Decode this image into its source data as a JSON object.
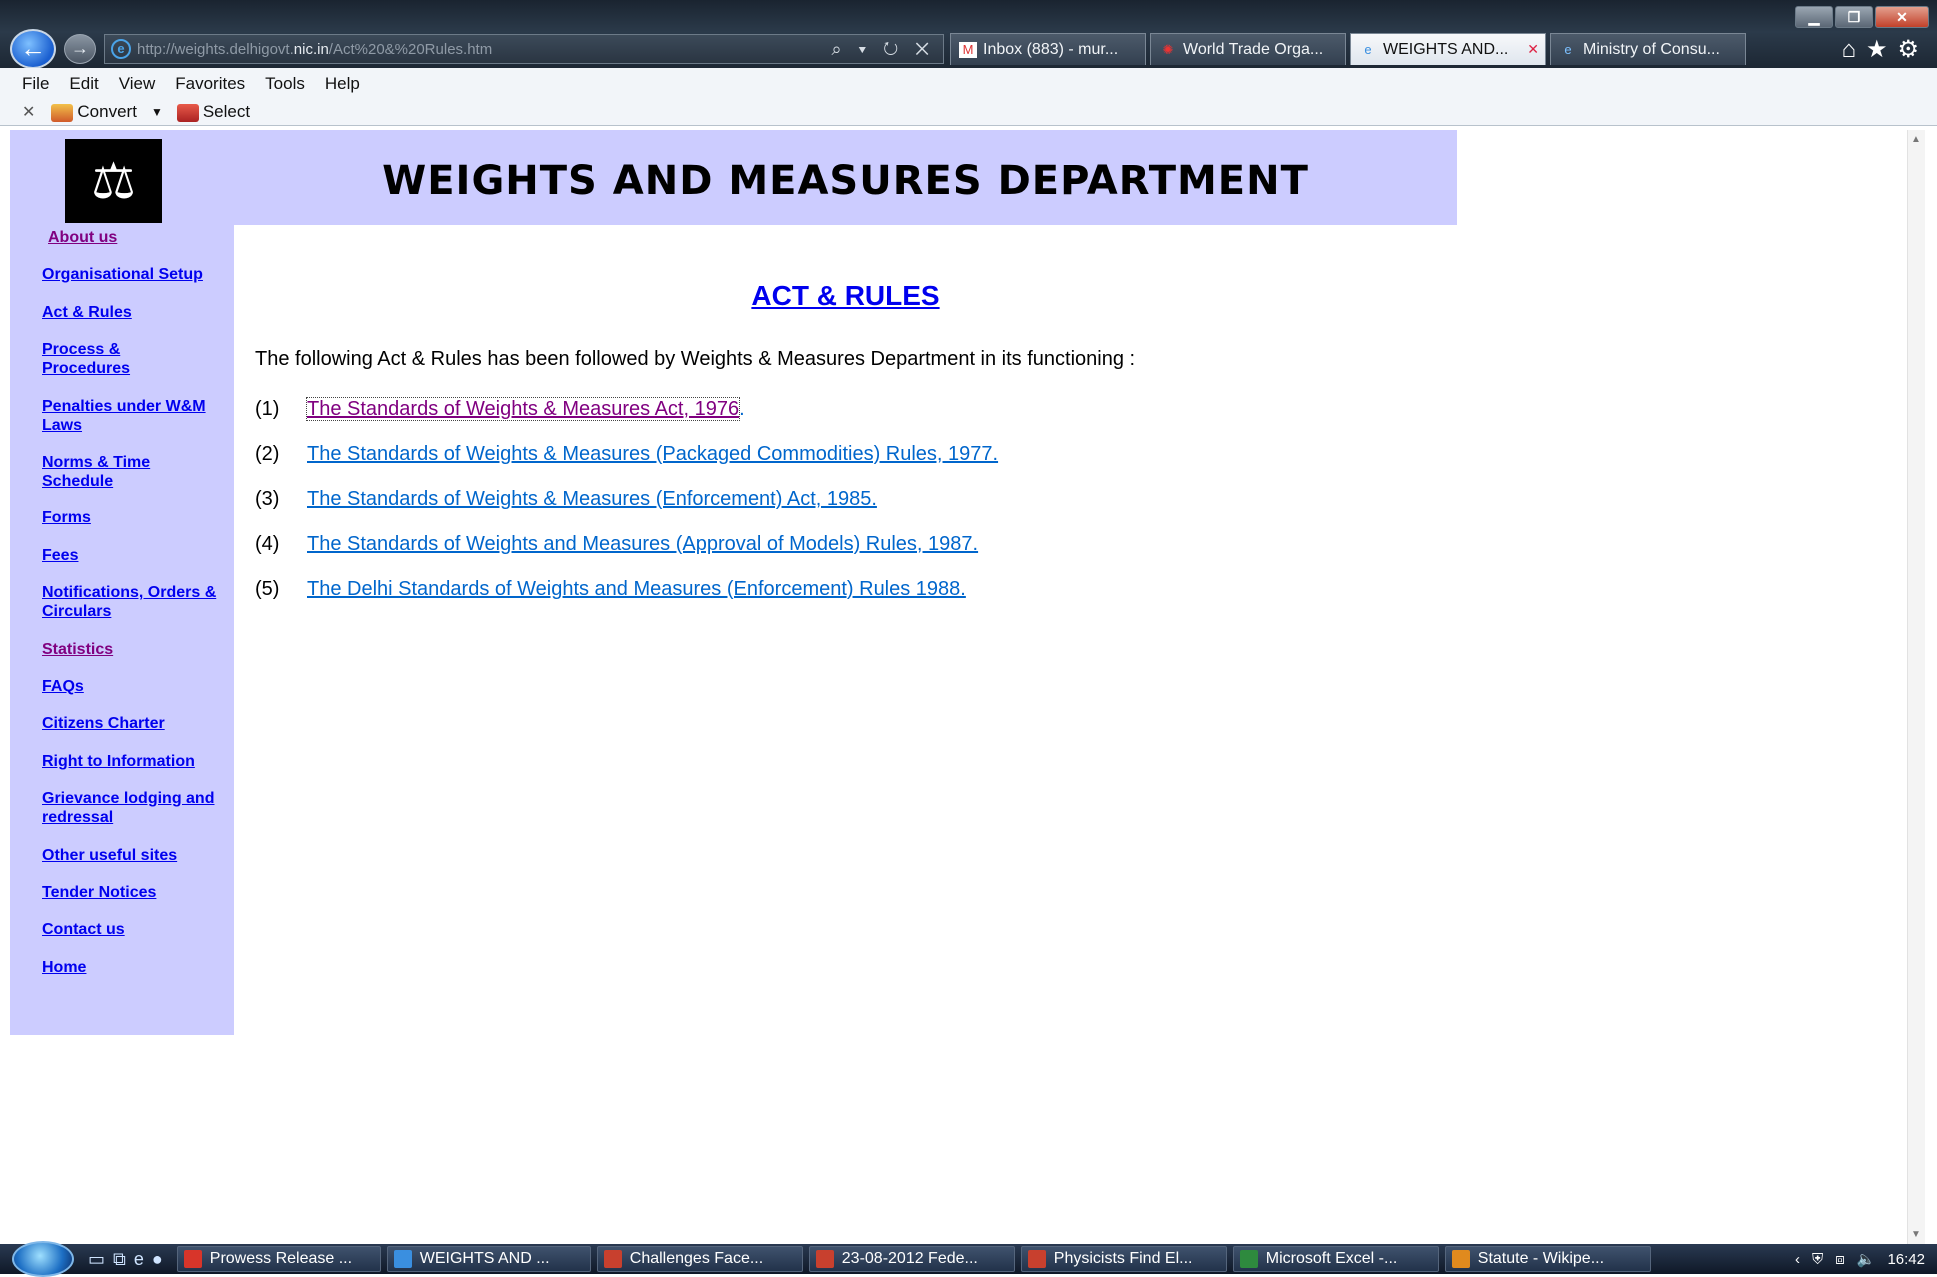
{
  "browser": {
    "url_prefix": "http://weights.delhigovt.",
    "url_host": "nic.in",
    "url_suffix": "/Act%20&%20Rules.htm",
    "address_tools": "⌕ ▾ ↻ ✕",
    "tabs": [
      {
        "label": "Inbox (883) - mur...",
        "icon": "gmail-icon"
      },
      {
        "label": "World Trade Orga...",
        "icon": "wto-icon"
      },
      {
        "label": "WEIGHTS AND...",
        "icon": "ie-page-icon",
        "active": true
      },
      {
        "label": "Ministry of Consu...",
        "icon": "ie-page-icon"
      }
    ],
    "menu": [
      "File",
      "Edit",
      "View",
      "Favorites",
      "Tools",
      "Help"
    ],
    "commands": {
      "convert": "Convert",
      "select": "Select"
    }
  },
  "site": {
    "title": "WEIGHTS AND MEASURES DEPARTMENT",
    "nav": [
      {
        "label": "About us",
        "visited": true
      },
      {
        "label": "Organisational Setup"
      },
      {
        "label": "Act & Rules"
      },
      {
        "label": "Process & Procedures"
      },
      {
        "label": "Penalties under W&M Laws"
      },
      {
        "label": "Norms & Time Schedule"
      },
      {
        "label": "Forms"
      },
      {
        "label": "Fees"
      },
      {
        "label": "Notifications, Orders & Circulars"
      },
      {
        "label": "Statistics",
        "visited": true
      },
      {
        "label": "FAQs"
      },
      {
        "label": "Citizens Charter"
      },
      {
        "label": "Right to Information"
      },
      {
        "label": "Grievance lodging and redressal"
      },
      {
        "label": "Other useful sites"
      },
      {
        "label": "Tender Notices"
      },
      {
        "label": "Contact us"
      },
      {
        "label": "Home"
      }
    ]
  },
  "content": {
    "heading": "ACT & RULES",
    "intro": "The following Act & Rules has been followed by Weights & Measures Department in its functioning :",
    "acts": [
      {
        "num": "(1)",
        "title": "The Standards of Weights & Measures Act, 1976",
        "trailer": ".",
        "visited": true
      },
      {
        "num": "(2)",
        "title": "The Standards of Weights & Measures (Packaged Commodities) Rules, 1977."
      },
      {
        "num": "(3)",
        "title": "The Standards of Weights & Measures (Enforcement) Act, 1985."
      },
      {
        "num": "(4)",
        "title": "The Standards of Weights and Measures (Approval of Models) Rules, 1987."
      },
      {
        "num": "(5)",
        "title": "The Delhi Standards of Weights and Measures (Enforcement) Rules 1988."
      }
    ]
  },
  "taskbar": {
    "items": [
      {
        "label": "Prowess Release ...",
        "color": "#d8352a"
      },
      {
        "label": "WEIGHTS AND ...",
        "color": "#3a8fe0"
      },
      {
        "label": "Challenges Face...",
        "color": "#c8402e"
      },
      {
        "label": "23-08-2012 Fede...",
        "color": "#c8402e"
      },
      {
        "label": "Physicists Find El...",
        "color": "#c8402e"
      },
      {
        "label": "Microsoft Excel -...",
        "color": "#2e8a3e"
      },
      {
        "label": "Statute - Wikipe...",
        "color": "#e08a1e"
      }
    ],
    "clock": "16:42"
  }
}
